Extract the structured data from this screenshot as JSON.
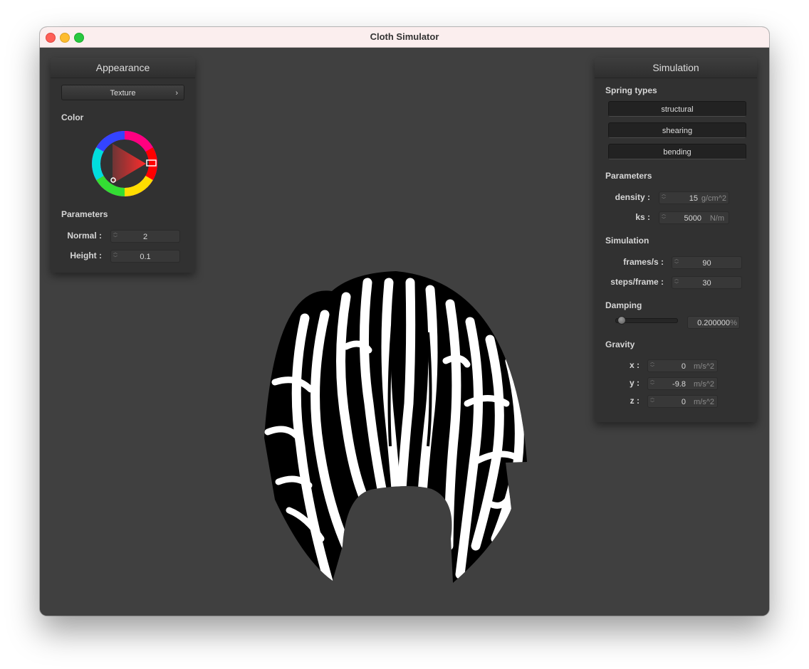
{
  "window": {
    "title": "Cloth Simulator"
  },
  "appearance": {
    "title": "Appearance",
    "shader_button": "Texture",
    "color_label": "Color",
    "color_value": "#ff0000",
    "parameters_label": "Parameters",
    "normal": {
      "label": "Normal :",
      "value": "2"
    },
    "height": {
      "label": "Height :",
      "value": "0.1"
    }
  },
  "simulation": {
    "title": "Simulation",
    "spring_types_label": "Spring types",
    "spring_buttons": [
      "structural",
      "shearing",
      "bending"
    ],
    "parameters_label": "Parameters",
    "density": {
      "label": "density :",
      "value": "15",
      "unit": "g/cm^2"
    },
    "ks": {
      "label": "ks :",
      "value": "5000",
      "unit": "N/m"
    },
    "simulation_label": "Simulation",
    "frames": {
      "label": "frames/s :",
      "value": "90"
    },
    "steps": {
      "label": "steps/frame :",
      "value": "30"
    },
    "damping_label": "Damping",
    "damping": {
      "value": "0.200000",
      "unit": "%",
      "fraction": 0.2
    },
    "gravity_label": "Gravity",
    "gravity": {
      "x": {
        "label": "x :",
        "value": "0",
        "unit": "m/s^2"
      },
      "y": {
        "label": "y :",
        "value": "-9.8",
        "unit": "m/s^2"
      },
      "z": {
        "label": "z :",
        "value": "0",
        "unit": "m/s^2"
      }
    }
  },
  "cloth": {
    "pattern": "zebra-stripes",
    "colors": [
      "#000000",
      "#ffffff"
    ]
  }
}
